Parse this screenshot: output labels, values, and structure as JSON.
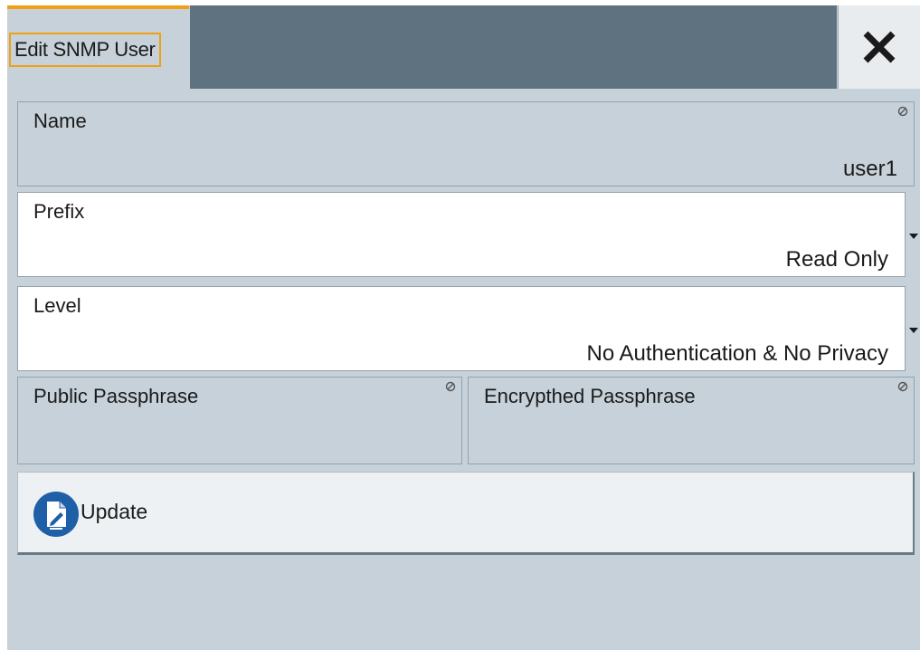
{
  "dialog": {
    "title": "Edit SNMP User",
    "close_icon": "close-icon"
  },
  "fields": {
    "name": {
      "label": "Name",
      "value": "user1"
    },
    "prefix": {
      "label": "Prefix",
      "value": "Read Only"
    },
    "level": {
      "label": "Level",
      "value": "No Authentication & No Privacy"
    },
    "public_passphrase": {
      "label": "Public Passphrase",
      "value": ""
    },
    "encrypted_passphrase": {
      "label": "Encrypthed Passphrase",
      "value": ""
    }
  },
  "update_button": {
    "label": "Update",
    "icon": "edit-document-icon"
  },
  "colors": {
    "accent": "#f0a010",
    "titlebar": "#5e7280",
    "panel": "#c6d1d9",
    "icon_blue": "#1f5fa8"
  }
}
